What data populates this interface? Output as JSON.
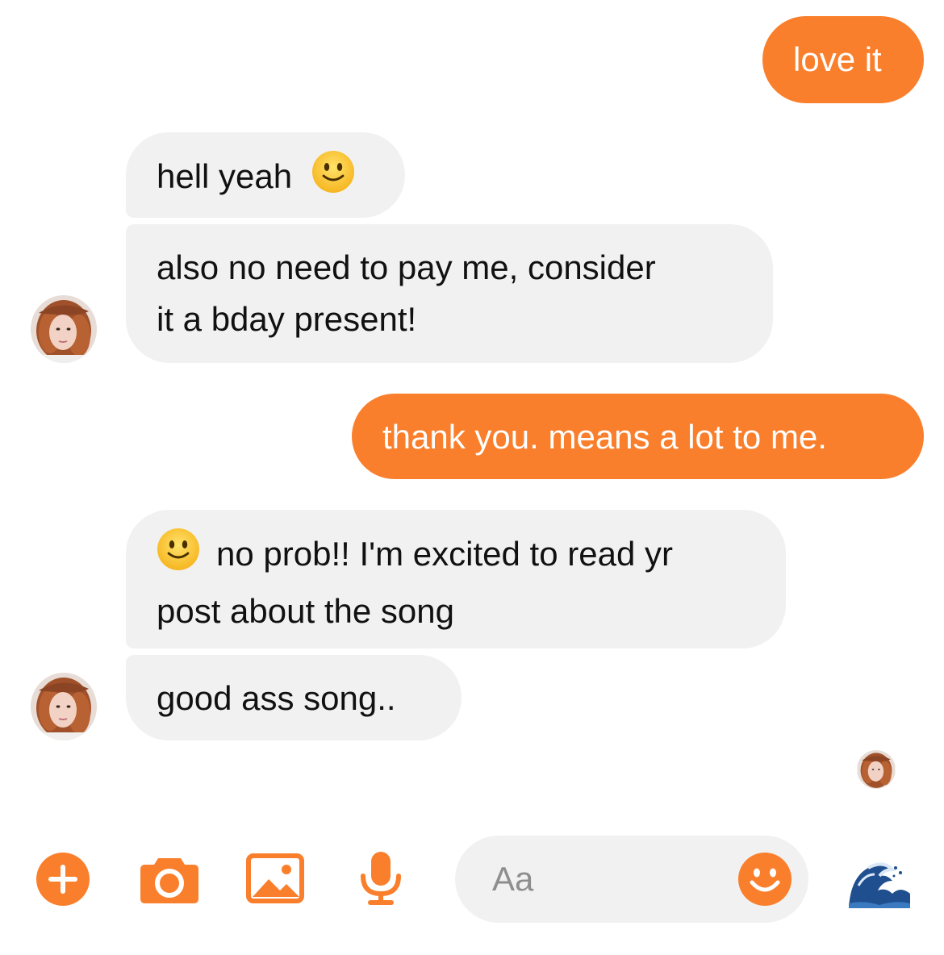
{
  "conversation": {
    "messages": [
      {
        "sender": "me",
        "text": "love it"
      },
      {
        "sender": "them",
        "text": "hell yeah",
        "emoji": "slightly-smiling-face"
      },
      {
        "sender": "them",
        "lines": [
          "also no need to pay me, consider",
          "it a bday present!"
        ]
      },
      {
        "sender": "me",
        "text": "thank you. means a lot to me."
      },
      {
        "sender": "them",
        "emoji": "slightly-smiling-face",
        "lines": [
          "no prob!! I'm excited to read yr",
          "post about the song"
        ]
      },
      {
        "sender": "them",
        "text": "good ass song.."
      }
    ]
  },
  "composer": {
    "placeholder": "Aa",
    "icons": [
      "plus-circle-icon",
      "camera-icon",
      "image-icon",
      "microphone-icon",
      "emoji-icon",
      "wave-emoji-icon"
    ]
  },
  "colors": {
    "accent": "#fa7f2c",
    "incoming_bubble": "#f1f1f1",
    "text": "#111111",
    "placeholder": "#8e8e8e"
  }
}
